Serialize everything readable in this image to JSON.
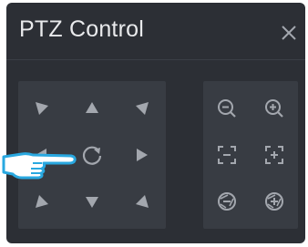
{
  "window": {
    "title": "PTZ Control"
  },
  "icons": {
    "close": "close-icon",
    "up_left": "arrow-up-left-icon",
    "up": "arrow-up-icon",
    "up_right": "arrow-up-right-icon",
    "left": "arrow-left-icon",
    "auto_scan": "rotate-icon",
    "right": "arrow-right-icon",
    "down_left": "arrow-down-left-icon",
    "down": "arrow-down-icon",
    "down_right": "arrow-down-right-icon",
    "zoom_out": "zoom-out-icon",
    "zoom_in": "zoom-in-icon",
    "focus_near": "focus-minus-icon",
    "focus_far": "focus-plus-icon",
    "iris_close": "iris-minus-icon",
    "iris_open": "iris-plus-icon",
    "pointer": "pointing-hand-icon"
  },
  "colors": {
    "window_bg": "#2c2f35",
    "panel_bg": "#383c43",
    "icon": "#a3a7ae",
    "title_text": "#e9eaec",
    "pointer": "#29a8e0"
  }
}
